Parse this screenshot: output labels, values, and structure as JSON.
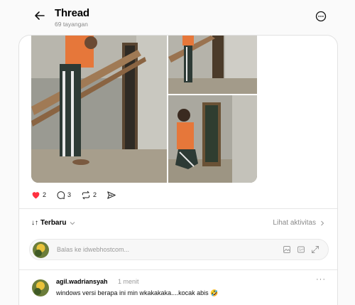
{
  "header": {
    "title": "Thread",
    "views": "69 tayangan"
  },
  "post": {
    "photos": [
      "man-installing-window-1",
      "man-installing-window-2",
      "man-installing-window-3"
    ],
    "likes": "2",
    "comments": "3",
    "reposts": "2",
    "like_color": "#ff3040"
  },
  "sort": {
    "label": "Terbaru",
    "arrow": "↓↑",
    "activity": "Lihat aktivitas"
  },
  "reply": {
    "placeholder": "Balas ke idwebhostcom..."
  },
  "comment": {
    "username": "agil.wadriansyah",
    "time": "1 menit",
    "text": "windows versi berapa ini min wkakakaka....kocak abis 🤣",
    "more": "···"
  }
}
